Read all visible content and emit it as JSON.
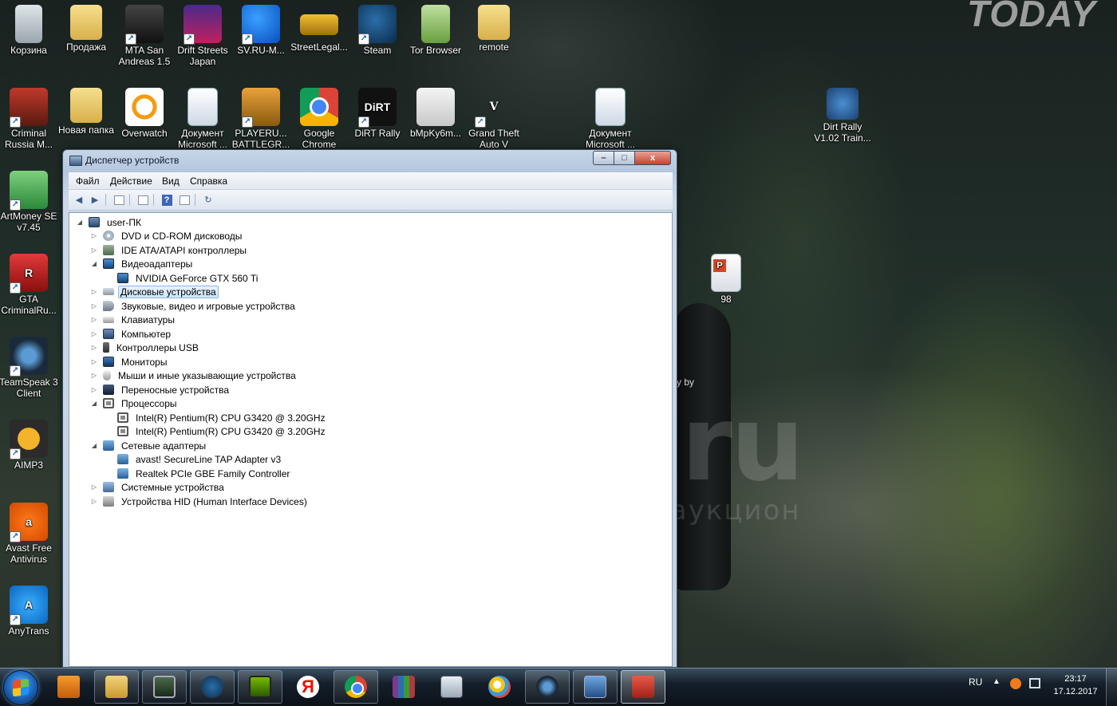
{
  "wallpaper": {
    "brand": "TODAY",
    "watermark_logo": "au.ru",
    "watermark_sub": "интернет-аукцион",
    "behind_window_text": "y by"
  },
  "desktop_icons": [
    {
      "label": "Корзина",
      "icon": "recycle-bin-icon"
    },
    {
      "label": "Продажа",
      "icon": "folder-icon"
    },
    {
      "label": "MTA San Andreas 1.5",
      "icon": "mta-icon"
    },
    {
      "label": "Drift Streets Japan",
      "icon": "drift-streets-icon"
    },
    {
      "label": "SV.RU-M...",
      "icon": "svru-icon"
    },
    {
      "label": "StreetLegal...",
      "icon": "street-legal-icon"
    },
    {
      "label": "Steam",
      "icon": "steam-icon"
    },
    {
      "label": "Tor Browser",
      "icon": "tor-browser-icon"
    },
    {
      "label": "remote",
      "icon": "folder-icon"
    },
    {
      "label": "Criminal Russia M...",
      "icon": "criminal-russia-icon"
    },
    {
      "label": "Новая папка",
      "icon": "folder-icon"
    },
    {
      "label": "Overwatch",
      "icon": "overwatch-icon"
    },
    {
      "label": "Документ Microsoft ...",
      "icon": "word-document-icon"
    },
    {
      "label": "PLAYERU... BATTLEGR...",
      "icon": "pubg-icon"
    },
    {
      "label": "Google Chrome",
      "icon": "chrome-icon"
    },
    {
      "label": "DiRT Rally",
      "icon": "dirt-rally-icon"
    },
    {
      "label": "bMpKy6m...",
      "icon": "gamepad-image-icon"
    },
    {
      "label": "Grand Theft Auto V",
      "icon": "gta-v-icon"
    },
    {
      "label": "Документ Microsoft ...",
      "icon": "word-document-icon"
    },
    {
      "label": "Dirt Rally V1.02 Train...",
      "icon": "trainer-icon"
    },
    {
      "label": "ArtMoney SE v7.45",
      "icon": "artmoney-icon"
    },
    {
      "label": "GTA CriminalRu...",
      "icon": "gta-criminal-russia-icon"
    },
    {
      "label": "TeamSpeak 3 Client",
      "icon": "teamspeak-icon"
    },
    {
      "label": "AIMP3",
      "icon": "aimp-icon"
    },
    {
      "label": "Avast Free Antivirus",
      "icon": "avast-icon"
    },
    {
      "label": "AnyTrans",
      "icon": "anytrans-icon"
    },
    {
      "label": "98",
      "icon": "powerpoint-document-icon"
    }
  ],
  "device_manager": {
    "title": "Диспетчер устройств",
    "window_buttons": {
      "minimize": "–",
      "maximize": "□",
      "close": "x"
    },
    "menu": [
      "Файл",
      "Действие",
      "Вид",
      "Справка"
    ],
    "toolbar": {
      "back": "◀",
      "forward": "▶",
      "help": "?",
      "scan": "↻"
    },
    "tree": {
      "root": "user-ПК",
      "nodes": [
        {
          "label": "DVD и CD-ROM дисководы",
          "expanded": false,
          "icon": "disc"
        },
        {
          "label": "IDE ATA/ATAPI контроллеры",
          "expanded": false,
          "icon": "ide"
        },
        {
          "label": "Видеоадаптеры",
          "expanded": true,
          "icon": "display",
          "children": [
            "NVIDIA GeForce GTX 560 Ti"
          ]
        },
        {
          "label": "Дисковые устройства",
          "expanded": false,
          "icon": "disk",
          "selected": true
        },
        {
          "label": "Звуковые, видео и игровые устройства",
          "expanded": false,
          "icon": "sound"
        },
        {
          "label": "Клавиатуры",
          "expanded": false,
          "icon": "keyboard"
        },
        {
          "label": "Компьютер",
          "expanded": false,
          "icon": "computer"
        },
        {
          "label": "Контроллеры USB",
          "expanded": false,
          "icon": "usb"
        },
        {
          "label": "Мониторы",
          "expanded": false,
          "icon": "monitor"
        },
        {
          "label": "Мыши и иные указывающие устройства",
          "expanded": false,
          "icon": "mouse"
        },
        {
          "label": "Переносные устройства",
          "expanded": false,
          "icon": "portable"
        },
        {
          "label": "Процессоры",
          "expanded": true,
          "icon": "cpu",
          "children": [
            "Intel(R) Pentium(R) CPU G3420 @ 3.20GHz",
            "Intel(R) Pentium(R) CPU G3420 @ 3.20GHz"
          ]
        },
        {
          "label": "Сетевые адаптеры",
          "expanded": true,
          "icon": "net",
          "children": [
            "avast! SecureLine TAP Adapter v3",
            "Realtek PCIe GBE Family Controller"
          ]
        },
        {
          "label": "Системные устройства",
          "expanded": false,
          "icon": "system"
        },
        {
          "label": "Устройства HID (Human Interface Devices)",
          "expanded": false,
          "icon": "hid"
        }
      ]
    }
  },
  "taskbar": {
    "pinned": [
      {
        "name": "media-player",
        "icon": "media-player-icon"
      },
      {
        "name": "explorer",
        "icon": "explorer-icon"
      },
      {
        "name": "task-manager",
        "icon": "task-manager-icon"
      },
      {
        "name": "steam",
        "icon": "steam-icon"
      },
      {
        "name": "nvidia",
        "icon": "nvidia-icon"
      },
      {
        "name": "yandex",
        "icon": "yandex-icon"
      },
      {
        "name": "chrome",
        "icon": "chrome-icon"
      },
      {
        "name": "winrar",
        "icon": "winrar-icon"
      },
      {
        "name": "calculator",
        "icon": "calculator-icon"
      },
      {
        "name": "paint",
        "icon": "paint-icon"
      },
      {
        "name": "teamspeak",
        "icon": "teamspeak-icon"
      },
      {
        "name": "network",
        "icon": "network-icon"
      },
      {
        "name": "device-manager",
        "icon": "toolbox-icon"
      }
    ],
    "yandex_glyph": "Я",
    "tray": {
      "language": "RU",
      "show_hidden": "▲",
      "time": "23:17",
      "date": "17.12.2017"
    }
  }
}
